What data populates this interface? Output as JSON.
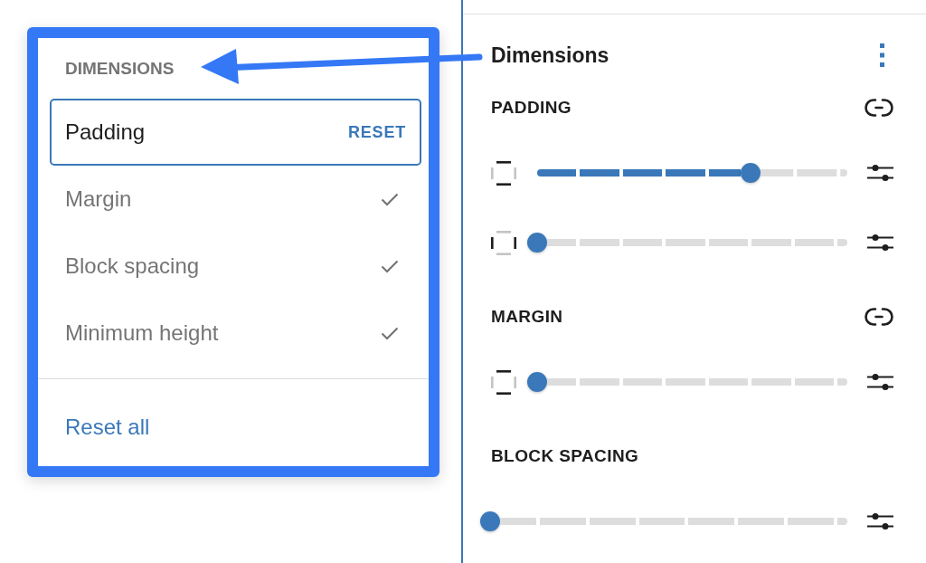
{
  "popover": {
    "heading": "DIMENSIONS",
    "items": [
      {
        "label": "Padding",
        "selected": true,
        "checked": true,
        "action": "RESET"
      },
      {
        "label": "Margin",
        "selected": false,
        "checked": true
      },
      {
        "label": "Block spacing",
        "selected": false,
        "checked": true
      },
      {
        "label": "Minimum height",
        "selected": false,
        "checked": true
      }
    ],
    "footer_button": "Reset all"
  },
  "panel": {
    "title": "Dimensions",
    "sections": [
      {
        "label": "PADDING",
        "unlink_button": true,
        "sliders": [
          {
            "kind": "vertical",
            "level": 0.71
          },
          {
            "kind": "horizontal",
            "level": 0
          }
        ]
      },
      {
        "label": "MARGIN",
        "unlink_button": true,
        "sliders": [
          {
            "kind": "vertical",
            "level": 0
          }
        ]
      },
      {
        "label": "BLOCK SPACING",
        "unlink_button": false,
        "sliders": [
          {
            "kind": "plain",
            "level": 0
          }
        ]
      }
    ]
  }
}
